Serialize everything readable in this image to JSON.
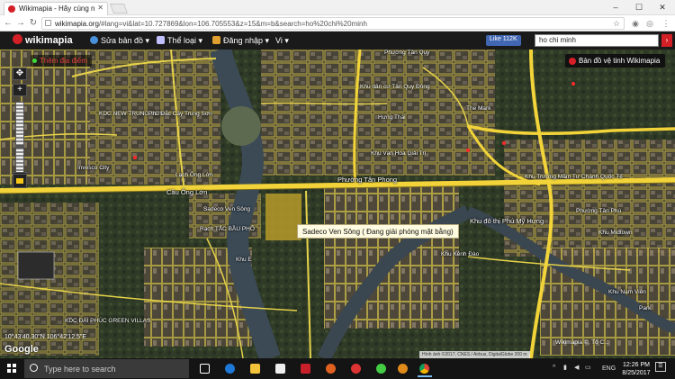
{
  "browser": {
    "tab_title": "Wikimapia - Hãy cùng n",
    "url_host": "wikimapia.org",
    "url_rest": "/#lang=vi&lat=10.727869&lon=106.705553&z=15&m=b&search=ho%20chi%20minh"
  },
  "header": {
    "logo": "wikimapia",
    "menu": [
      {
        "label": "Sửa bản đồ ▾",
        "icon": "globe-icon"
      },
      {
        "label": "Thể loại ▾",
        "icon": "grid-icon"
      },
      {
        "label": "Đăng nhập ▾",
        "icon": "login-icon"
      },
      {
        "label": "Vi ▾",
        "icon": ""
      }
    ],
    "like_label": "Like 112K",
    "search_value": "ho chi minh"
  },
  "map": {
    "add_place": "Thêm địa điểm",
    "satellite_button": "Bản đồ vệ tinh Wikimapia",
    "tooltip": "Sadeco Ven Sông ( Đang giải phóng mặt bằng)",
    "coords": "10°43'40.30\"N 106°42'12.5\"E",
    "google": "Google",
    "attribution": "Hình ảnh ©2017, CNES / Airbus, DigitalGlobe   200 m",
    "wm_copy": "Wikimapia ©, Tổ C...",
    "labels": [
      "KDC NEW TRUNG SƠN",
      "Phú Đắc Cây Trung Sơn",
      "Phường Tân Quy",
      "Khu dân cư Tân Quy Đông",
      "The Mark",
      "Hưng Thái",
      "Khu Vạn Hoa Giải Trí",
      "Phường Tân Phong",
      "Cầu Ông Lớn",
      "Sadeco Ven Sông",
      "Rạch TẮC BẦU PHỐ",
      "Khu đô thị Phú Mỹ Hưng",
      "Khu Trường Mầm Tư Chánh Quốc Tế",
      "Phường Tân Phú",
      "Khu Midtown",
      "Khu Kênh Đào",
      "Khu E",
      "KDC ĐẠI PHÚC GREEN VILLAS",
      "Khu Nam Viên",
      "Park",
      "Invesco City",
      "Lạch Ông Lớn"
    ]
  },
  "taskbar": {
    "search_placeholder": "Type here to search",
    "lang": "ENG",
    "time": "12:26 PM",
    "date": "8/25/2017"
  }
}
